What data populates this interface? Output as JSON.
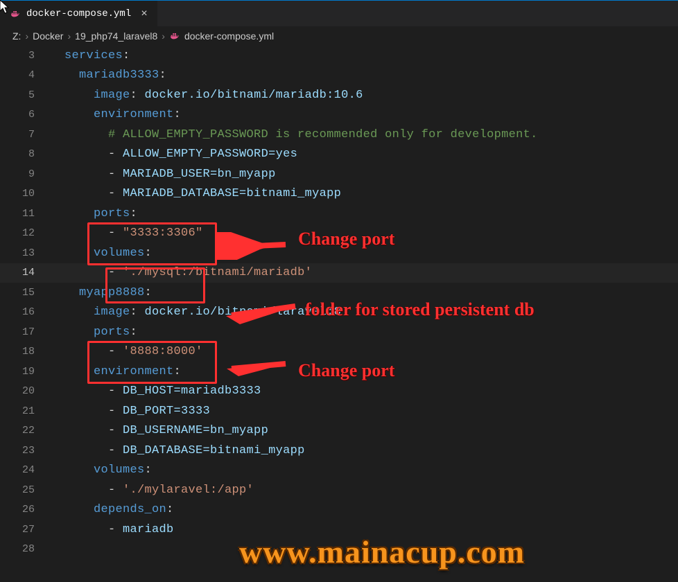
{
  "tab": {
    "filename": "docker-compose.yml",
    "icon": "docker-icon"
  },
  "breadcrumb": {
    "segments": [
      "Z:",
      "Docker",
      "19_php74_laravel8",
      "docker-compose.yml"
    ]
  },
  "lines": [
    {
      "n": 3,
      "indent": 2,
      "tokens": [
        {
          "c": "k-blue",
          "t": "services"
        },
        {
          "c": "k-punc",
          "t": ":"
        }
      ]
    },
    {
      "n": 4,
      "indent": 4,
      "tokens": [
        {
          "c": "k-blue",
          "t": "mariadb3333"
        },
        {
          "c": "k-punc",
          "t": ":"
        }
      ]
    },
    {
      "n": 5,
      "indent": 6,
      "tokens": [
        {
          "c": "k-blue",
          "t": "image"
        },
        {
          "c": "k-punc",
          "t": ": "
        },
        {
          "c": "k-cyan",
          "t": "docker.io/bitnami/mariadb:10.6"
        }
      ]
    },
    {
      "n": 6,
      "indent": 6,
      "tokens": [
        {
          "c": "k-blue",
          "t": "environment"
        },
        {
          "c": "k-punc",
          "t": ":"
        }
      ]
    },
    {
      "n": 7,
      "indent": 8,
      "tokens": [
        {
          "c": "k-cmt",
          "t": "# ALLOW_EMPTY_PASSWORD is recommended only for development."
        }
      ]
    },
    {
      "n": 8,
      "indent": 8,
      "tokens": [
        {
          "c": "k-dash",
          "t": "- "
        },
        {
          "c": "k-cyan",
          "t": "ALLOW_EMPTY_PASSWORD=yes"
        }
      ]
    },
    {
      "n": 9,
      "indent": 8,
      "tokens": [
        {
          "c": "k-dash",
          "t": "- "
        },
        {
          "c": "k-cyan",
          "t": "MARIADB_USER=bn_myapp"
        }
      ]
    },
    {
      "n": 10,
      "indent": 8,
      "tokens": [
        {
          "c": "k-dash",
          "t": "- "
        },
        {
          "c": "k-cyan",
          "t": "MARIADB_DATABASE=bitnami_myapp"
        }
      ]
    },
    {
      "n": 11,
      "indent": 6,
      "tokens": [
        {
          "c": "k-blue",
          "t": "ports"
        },
        {
          "c": "k-punc",
          "t": ":"
        }
      ]
    },
    {
      "n": 12,
      "indent": 8,
      "tokens": [
        {
          "c": "k-dash",
          "t": "- "
        },
        {
          "c": "k-str",
          "t": "\"3333:3306\""
        }
      ]
    },
    {
      "n": 13,
      "indent": 6,
      "tokens": [
        {
          "c": "k-blue",
          "t": "volumes"
        },
        {
          "c": "k-punc",
          "t": ":"
        }
      ]
    },
    {
      "n": 14,
      "indent": 8,
      "active": true,
      "tokens": [
        {
          "c": "k-dash",
          "t": "- "
        },
        {
          "c": "k-str",
          "t": "'./mysql:/bitnami/mariadb'"
        }
      ]
    },
    {
      "n": 15,
      "indent": 4,
      "tokens": [
        {
          "c": "k-blue",
          "t": "myapp8888"
        },
        {
          "c": "k-punc",
          "t": ":"
        }
      ]
    },
    {
      "n": 16,
      "indent": 6,
      "tokens": [
        {
          "c": "k-blue",
          "t": "image"
        },
        {
          "c": "k-punc",
          "t": ": "
        },
        {
          "c": "k-cyan",
          "t": "docker.io/bitnami/laravel:8"
        }
      ]
    },
    {
      "n": 17,
      "indent": 6,
      "tokens": [
        {
          "c": "k-blue",
          "t": "ports"
        },
        {
          "c": "k-punc",
          "t": ":"
        }
      ]
    },
    {
      "n": 18,
      "indent": 8,
      "tokens": [
        {
          "c": "k-dash",
          "t": "- "
        },
        {
          "c": "k-str",
          "t": "'8888:8000'"
        }
      ]
    },
    {
      "n": 19,
      "indent": 6,
      "tokens": [
        {
          "c": "k-blue",
          "t": "environment"
        },
        {
          "c": "k-punc",
          "t": ":"
        }
      ]
    },
    {
      "n": 20,
      "indent": 8,
      "tokens": [
        {
          "c": "k-dash",
          "t": "- "
        },
        {
          "c": "k-cyan",
          "t": "DB_HOST=mariadb3333"
        }
      ]
    },
    {
      "n": 21,
      "indent": 8,
      "tokens": [
        {
          "c": "k-dash",
          "t": "- "
        },
        {
          "c": "k-cyan",
          "t": "DB_PORT=3333"
        }
      ]
    },
    {
      "n": 22,
      "indent": 8,
      "tokens": [
        {
          "c": "k-dash",
          "t": "- "
        },
        {
          "c": "k-cyan",
          "t": "DB_USERNAME=bn_myapp"
        }
      ]
    },
    {
      "n": 23,
      "indent": 8,
      "tokens": [
        {
          "c": "k-dash",
          "t": "- "
        },
        {
          "c": "k-cyan",
          "t": "DB_DATABASE=bitnami_myapp"
        }
      ]
    },
    {
      "n": 24,
      "indent": 6,
      "tokens": [
        {
          "c": "k-blue",
          "t": "volumes"
        },
        {
          "c": "k-punc",
          "t": ":"
        }
      ]
    },
    {
      "n": 25,
      "indent": 8,
      "tokens": [
        {
          "c": "k-dash",
          "t": "- "
        },
        {
          "c": "k-str",
          "t": "'./mylaravel:/app'"
        }
      ]
    },
    {
      "n": 26,
      "indent": 6,
      "tokens": [
        {
          "c": "k-blue",
          "t": "depends_on"
        },
        {
          "c": "k-punc",
          "t": ":"
        }
      ]
    },
    {
      "n": 27,
      "indent": 8,
      "tokens": [
        {
          "c": "k-dash",
          "t": "- "
        },
        {
          "c": "k-cyan",
          "t": "mariadb"
        }
      ]
    },
    {
      "n": 28,
      "indent": 0,
      "tokens": []
    }
  ],
  "annotations": {
    "box1": {
      "label": "Change port"
    },
    "box2": {
      "label": "folder for stored persistent db"
    },
    "box3": {
      "label": "Change port"
    }
  },
  "watermark": "www.mainacup.com"
}
